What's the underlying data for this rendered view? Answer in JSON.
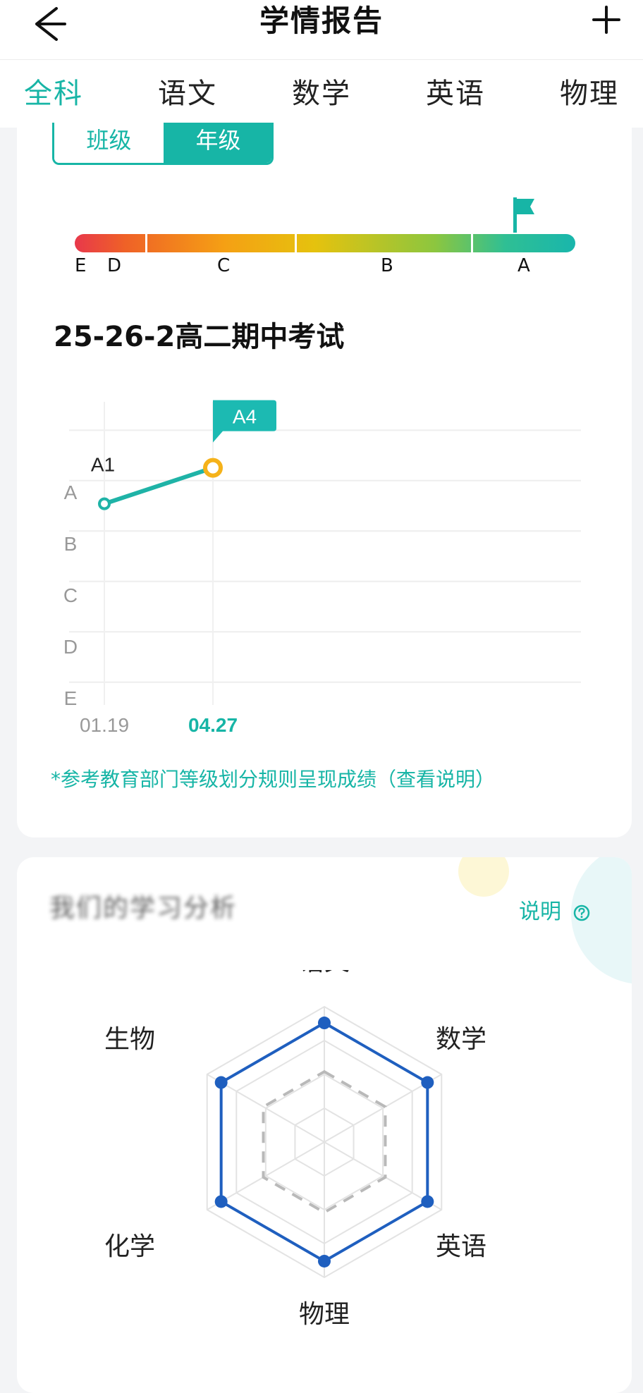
{
  "header": {
    "title": "学情报告",
    "back_icon": "arrow-left-icon",
    "plus_icon": "plus-icon"
  },
  "tabs": [
    {
      "label": "全科",
      "active": true
    },
    {
      "label": "语文",
      "active": false
    },
    {
      "label": "数学",
      "active": false
    },
    {
      "label": "英语",
      "active": false
    },
    {
      "label": "物理",
      "active": false
    }
  ],
  "scope_toggle": {
    "options": [
      "班级",
      "年级"
    ],
    "selected": "年级"
  },
  "grade_bar": {
    "labels": [
      "E",
      "D",
      "C",
      "B",
      "A"
    ],
    "flag_at": "A",
    "flag_icon": "flag-icon"
  },
  "exam_title": "25-26-2高二期中考试",
  "chart_data": {
    "type": "line",
    "x": [
      "01.19",
      "04.27"
    ],
    "y_levels": [
      "A",
      "B",
      "C",
      "D",
      "E"
    ],
    "series": [
      {
        "values": [
          "A1",
          "A4"
        ]
      }
    ],
    "point_labels": [
      "A1",
      "A4"
    ],
    "highlighted_index": 1,
    "grid": true
  },
  "note": "*参考教育部门等级划分规则呈现成绩（查看说明）",
  "section2": {
    "title": "我们的学习分析",
    "explain": "说明",
    "explain_icon": "help-circle-icon"
  },
  "radar_chart": {
    "type": "radar",
    "axes": [
      "语文",
      "数学",
      "英语",
      "物理",
      "化学",
      "生物"
    ],
    "series": [
      {
        "values": [
          0.88,
          0.88,
          0.88,
          0.88,
          0.88,
          0.88
        ],
        "color": "#1f5fbf"
      },
      {
        "values": [
          0.52,
          0.52,
          0.52,
          0.52,
          0.52,
          0.52
        ],
        "color": "#b9b9b9",
        "dashed": true
      }
    ]
  },
  "colors": {
    "accent": "#17b5a6",
    "marker_highlight": "#f5b21a",
    "radar_line": "#1f5fbf"
  }
}
